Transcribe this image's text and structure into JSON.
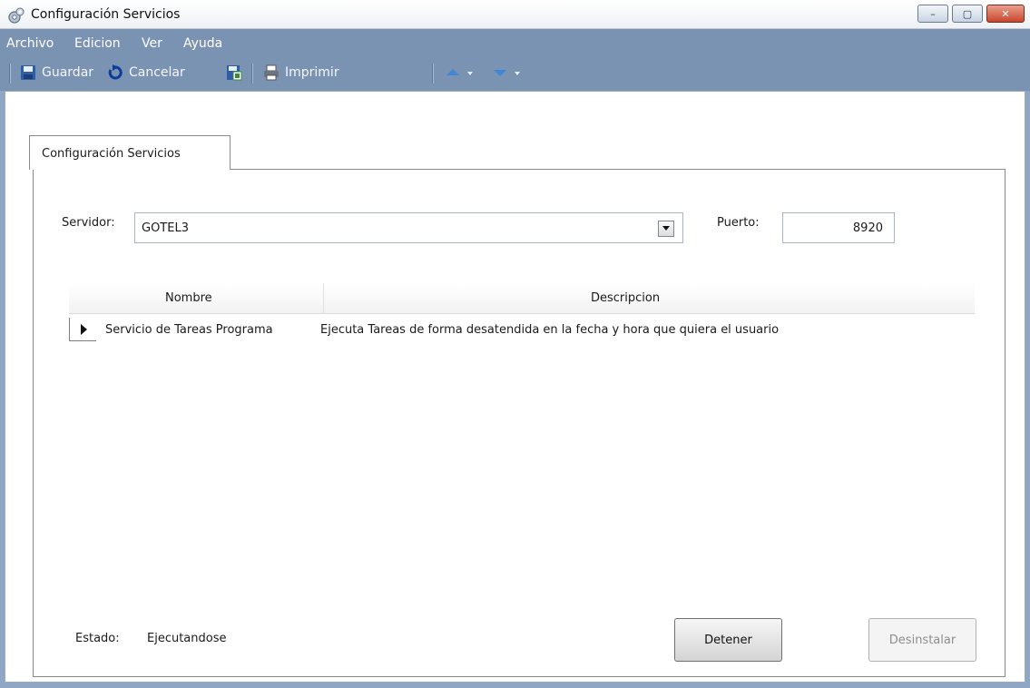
{
  "window": {
    "title": "Configuración Servicios",
    "minimize": "–",
    "maximize": "▢",
    "close": "✕"
  },
  "menu": {
    "items": [
      "Archivo",
      "Edicion",
      "Ver",
      "Ayuda"
    ]
  },
  "toolbar": {
    "save_label": "Guardar",
    "cancel_label": "Cancelar",
    "print_label": "Imprimir"
  },
  "tab": {
    "label": "Configuración Servicios"
  },
  "server": {
    "label": "Servidor:",
    "value": "GOTEL3"
  },
  "port": {
    "label": "Puerto:",
    "value": "8920"
  },
  "grid": {
    "columns": [
      "Nombre",
      "Descripcion"
    ],
    "rows": [
      {
        "nombre": "Servicio de Tareas Programa",
        "descripcion": "Ejecuta Tareas de forma desatendida en la fecha y hora que quiera el usuario"
      }
    ]
  },
  "status": {
    "label": "Estado:",
    "value": "Ejecutandose"
  },
  "buttons": {
    "stop": "Detener",
    "uninstall": "Desinstalar"
  },
  "colors": {
    "chrome": "#7b93b3",
    "close_button": "#c9452d"
  }
}
